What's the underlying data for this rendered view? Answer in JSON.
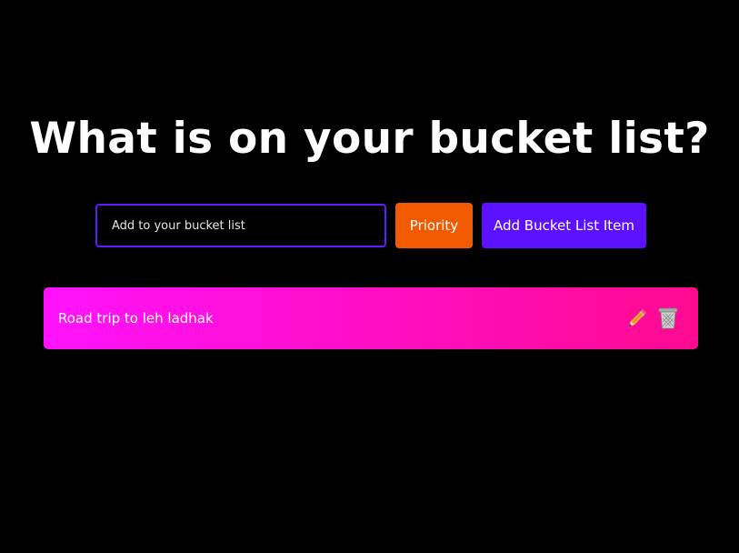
{
  "header": {
    "title": "What is on your bucket list?"
  },
  "form": {
    "input_placeholder": "Add to your bucket list",
    "input_value": "",
    "priority_label": "Priority",
    "add_label": "Add Bucket List Item"
  },
  "list": {
    "items": [
      {
        "text": "Road trip to leh ladhak",
        "edit_icon": "pencil-icon",
        "delete_icon": "trash-icon"
      }
    ]
  },
  "colors": {
    "background": "#000000",
    "input_border": "#5d1bff",
    "priority_button": "#f05a00",
    "add_button": "#5d12ff",
    "item_gradient_start": "#ff12fb",
    "item_gradient_end": "#ff0a90"
  }
}
